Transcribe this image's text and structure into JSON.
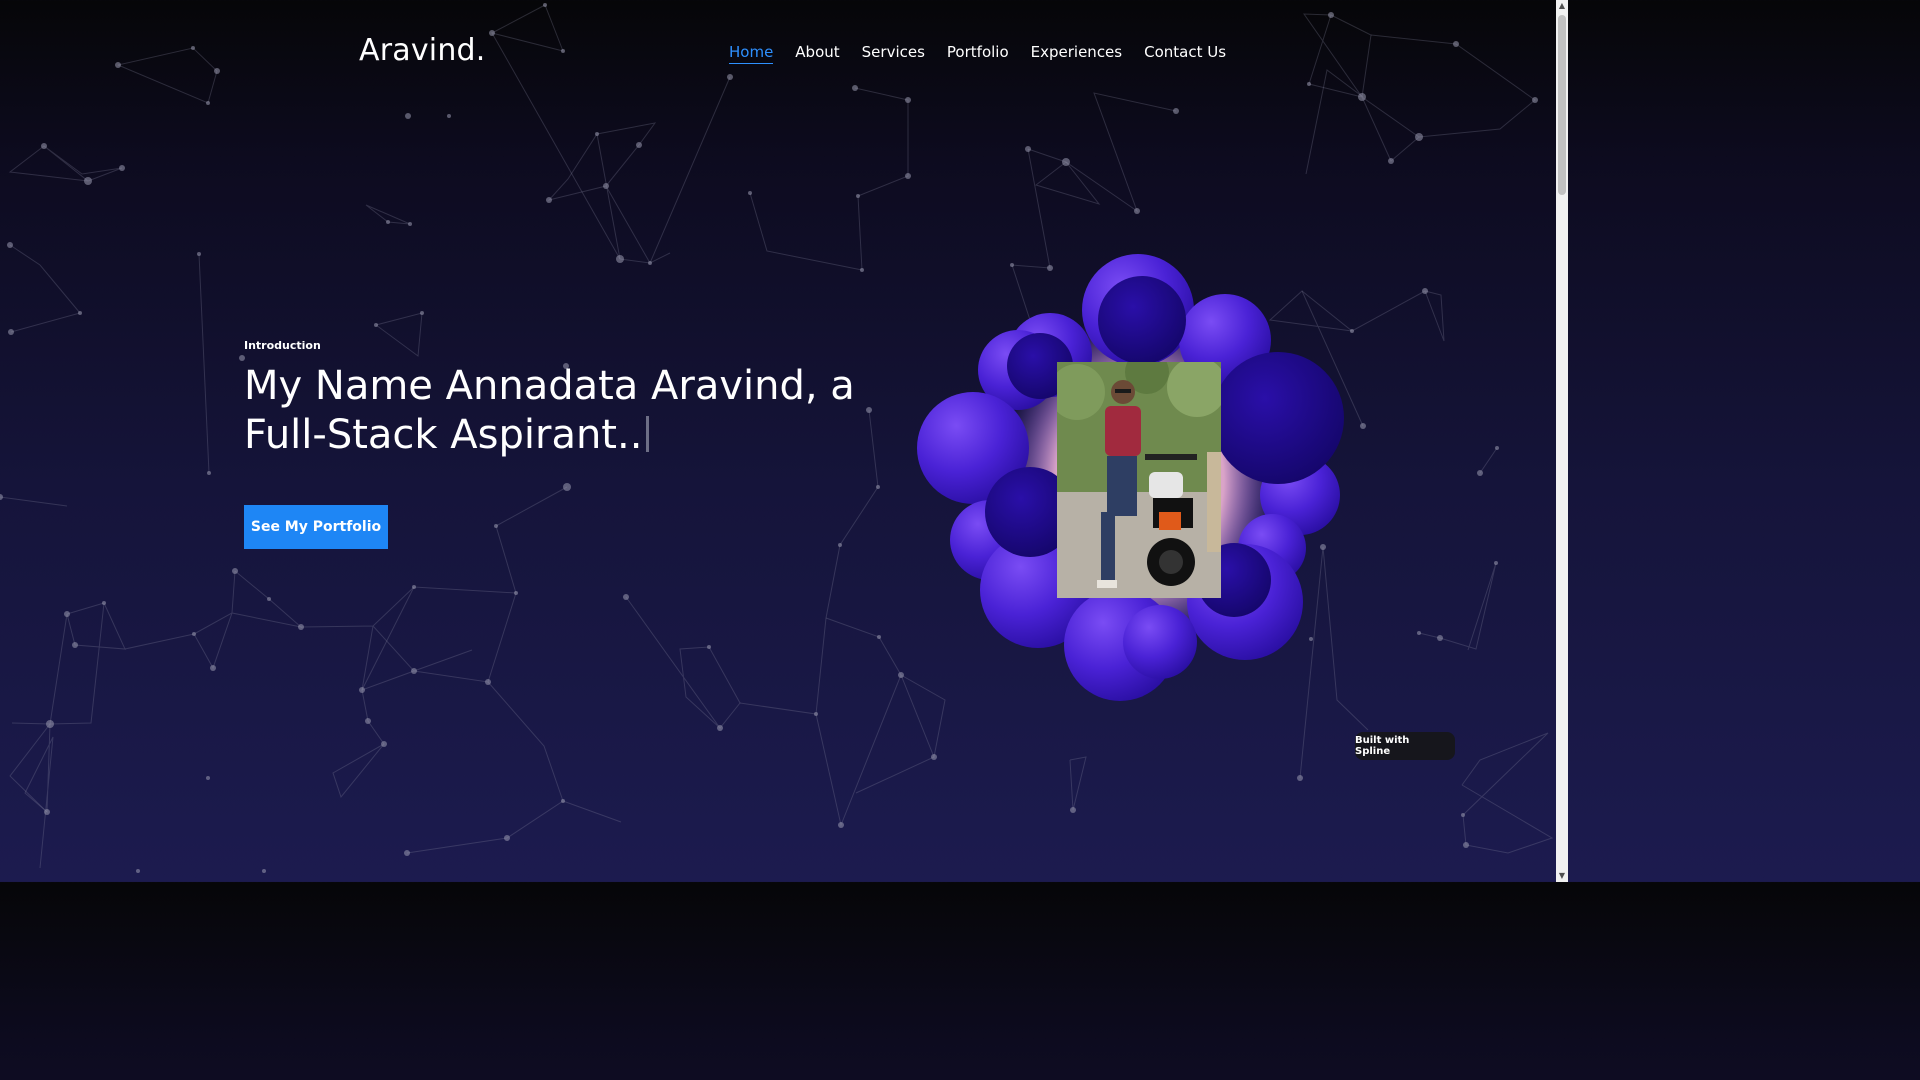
{
  "brand": "Aravind.",
  "nav": {
    "items": [
      {
        "label": "Home",
        "active": true
      },
      {
        "label": "About",
        "active": false
      },
      {
        "label": "Services",
        "active": false
      },
      {
        "label": "Portfolio",
        "active": false
      },
      {
        "label": "Experiences",
        "active": false
      },
      {
        "label": "Contact Us",
        "active": false
      }
    ]
  },
  "hero": {
    "intro_label": "Introduction",
    "title_line1": "My Name Annadata Aravind, a",
    "title_line2": "Full-Stack Aspirant..",
    "cta_label": "See My Portfolio"
  },
  "spline_badge": "Built with Spline",
  "colors": {
    "accent": "#1e86f5",
    "nav_active": "#2e90ff",
    "bubble": "#4a22d6",
    "bubble_dark": "#1f0a87",
    "glow": "#f2c89a"
  },
  "icons": {
    "scroll_up": "triangle-up-icon",
    "scroll_down": "triangle-down-icon"
  }
}
